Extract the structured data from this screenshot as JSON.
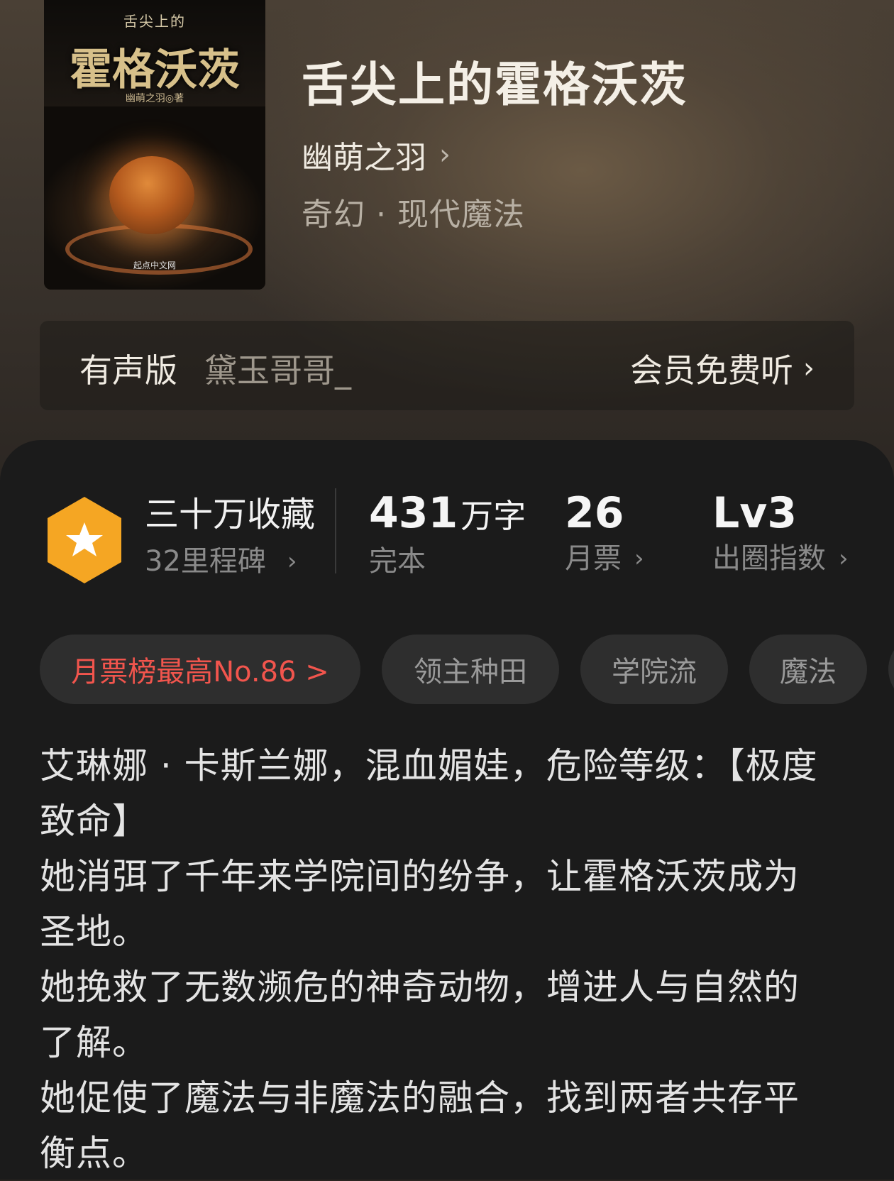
{
  "book": {
    "cover": {
      "small_title": "舌尖上的",
      "title": "霍格沃茨",
      "author_line": "幽萌之羽◎著",
      "publisher": "起点中文网"
    },
    "title": "舌尖上的霍格沃茨",
    "author": "幽萌之羽",
    "genre": "奇幻 · 现代魔法"
  },
  "audio": {
    "label": "有声版",
    "narrator": "黛玉哥哥_",
    "cta": "会员免费听"
  },
  "stats": {
    "collection": "三十万收藏",
    "milestones": "32里程碑",
    "words_value": "431",
    "words_unit": "万字",
    "words_status": "完本",
    "monthly_votes_value": "26",
    "monthly_votes_label": "月票",
    "level_value": "Lv3",
    "level_label": "出圈指数"
  },
  "tags": [
    "月票榜最高No.86 >",
    "领主种田",
    "学院流",
    "魔法"
  ],
  "description": [
    "艾琳娜 · 卡斯兰娜，混血媚娃，危险等级：【极度致命】",
    "她消弭了千年来学院间的纷争，让霍格沃茨成为圣地。",
    "她挽救了无数濒危的神奇动物，增进人与自然的了解。",
    "她促使了魔法与非魔法的融合，找到两者共存平衡点。"
  ],
  "colors": {
    "accent_red": "#f2554d",
    "badge_orange": "#f5a623",
    "panel_bg": "#1b1b1b"
  }
}
